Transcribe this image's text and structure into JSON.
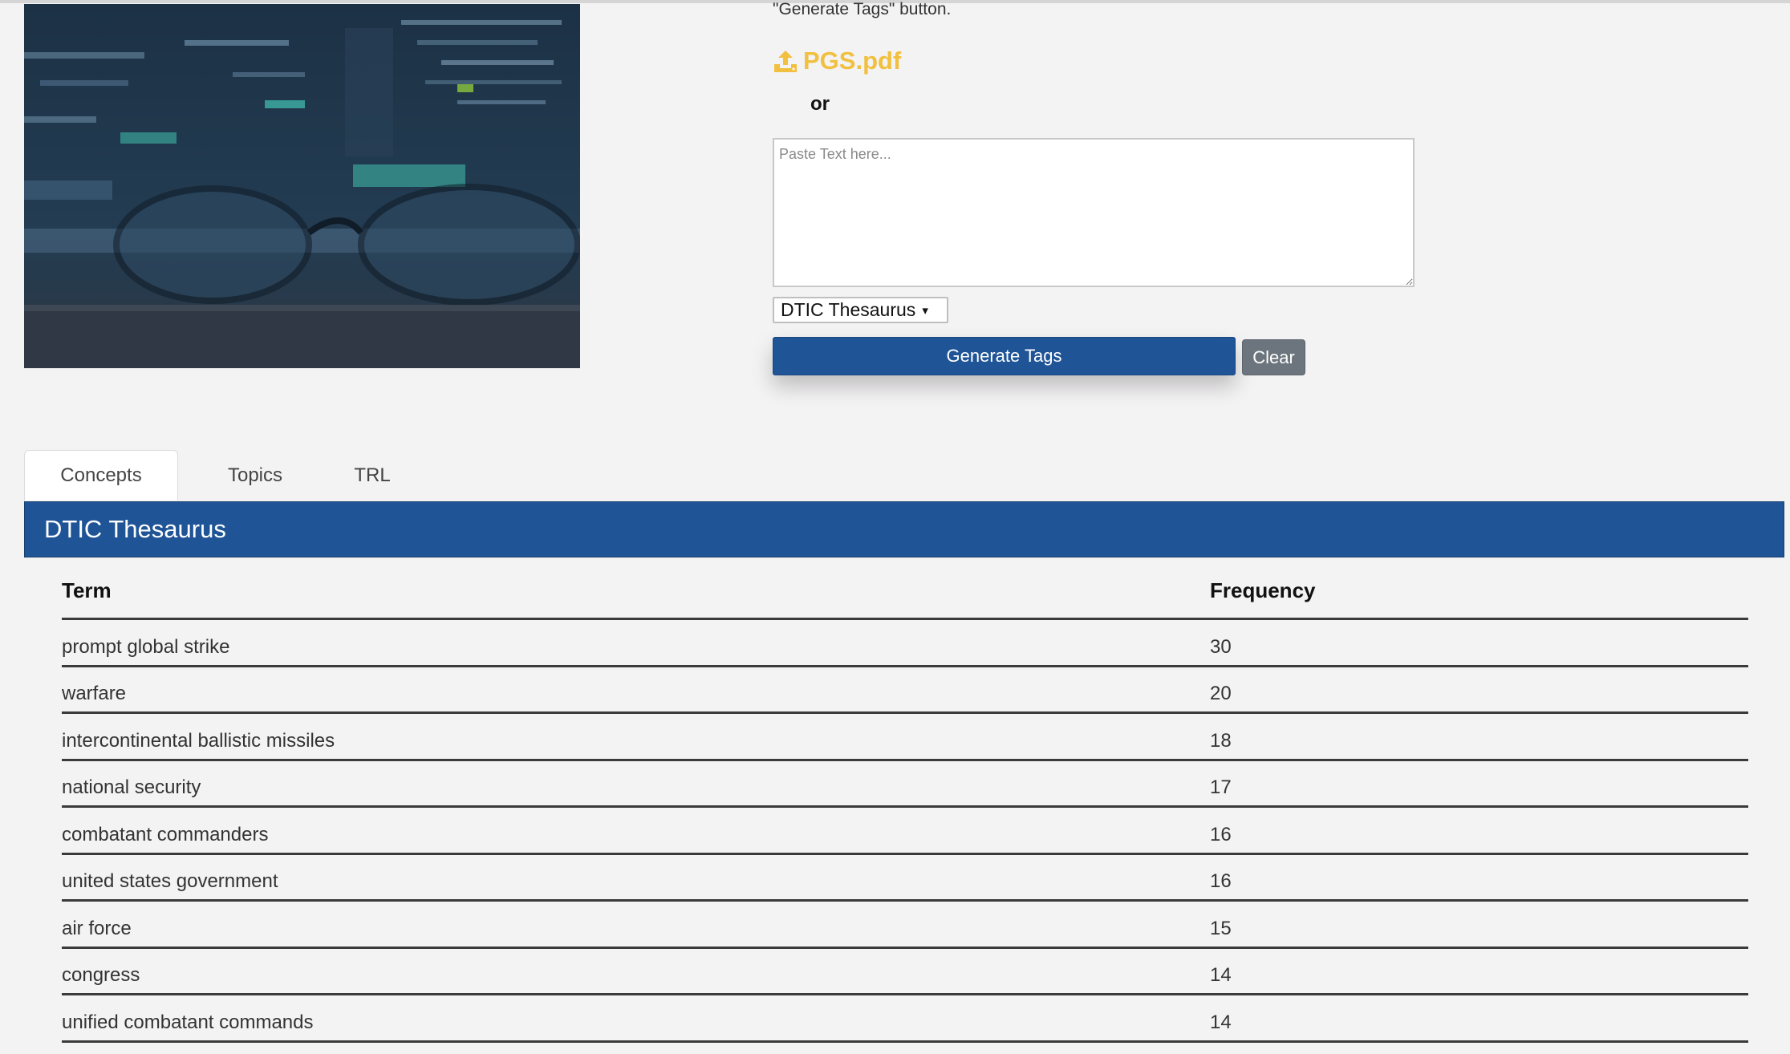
{
  "intro": {
    "text": "\"Generate Tags\" button."
  },
  "upload": {
    "icon": "upload-icon",
    "file_name": "PGS.pdf",
    "color": "#f1c040"
  },
  "separator": {
    "or_text": "or"
  },
  "paste": {
    "placeholder": "Paste Text here..."
  },
  "thesaurus_select": {
    "selected": "DTIC Thesaurus",
    "caret": "▾"
  },
  "buttons": {
    "generate": "Generate Tags",
    "clear": "Clear"
  },
  "tabs": [
    {
      "label": "Concepts",
      "active": true
    },
    {
      "label": "Topics",
      "active": false
    },
    {
      "label": "TRL",
      "active": false
    }
  ],
  "panel": {
    "title": "DTIC Thesaurus",
    "color": "#1f5496"
  },
  "table": {
    "headers": {
      "term": "Term",
      "frequency": "Frequency"
    },
    "rows": [
      {
        "term": "prompt global strike",
        "frequency": "30"
      },
      {
        "term": "warfare",
        "frequency": "20"
      },
      {
        "term": "intercontinental ballistic missiles",
        "frequency": "18"
      },
      {
        "term": "national security",
        "frequency": "17"
      },
      {
        "term": "combatant commanders",
        "frequency": "16"
      },
      {
        "term": "united states government",
        "frequency": "16"
      },
      {
        "term": "air force",
        "frequency": "15"
      },
      {
        "term": "congress",
        "frequency": "14"
      },
      {
        "term": "unified combatant commands",
        "frequency": "14"
      }
    ]
  }
}
